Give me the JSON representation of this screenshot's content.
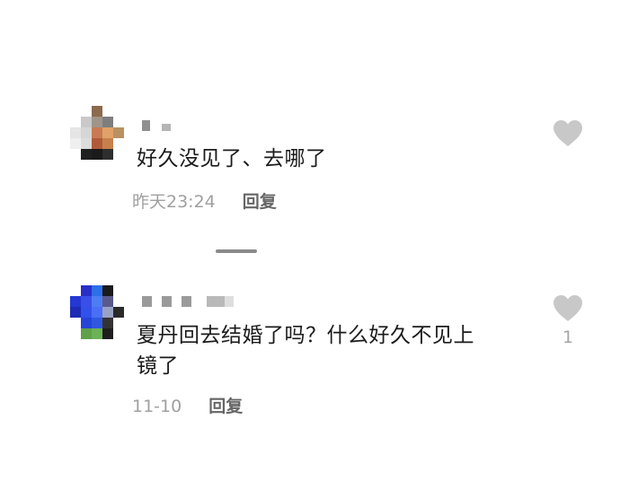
{
  "comments": [
    {
      "text": "好久没见了、去哪了",
      "time": "昨天23:24",
      "reply_label": "回复",
      "like_count": ""
    },
    {
      "text_line1": "夏丹回去结婚了吗？什么好久不见上",
      "text_line2": "镜了",
      "time": "11-10",
      "reply_label": "回复",
      "like_count": "1"
    }
  ],
  "icons": {
    "like": "heart-icon",
    "avatar": "avatar-pixelated"
  },
  "colors": {
    "text": "#1b1b1b",
    "meta_time": "#a0a0a0",
    "reply": "#666666",
    "heart": "#c8c8c8",
    "divider": "#8a8a8a"
  }
}
